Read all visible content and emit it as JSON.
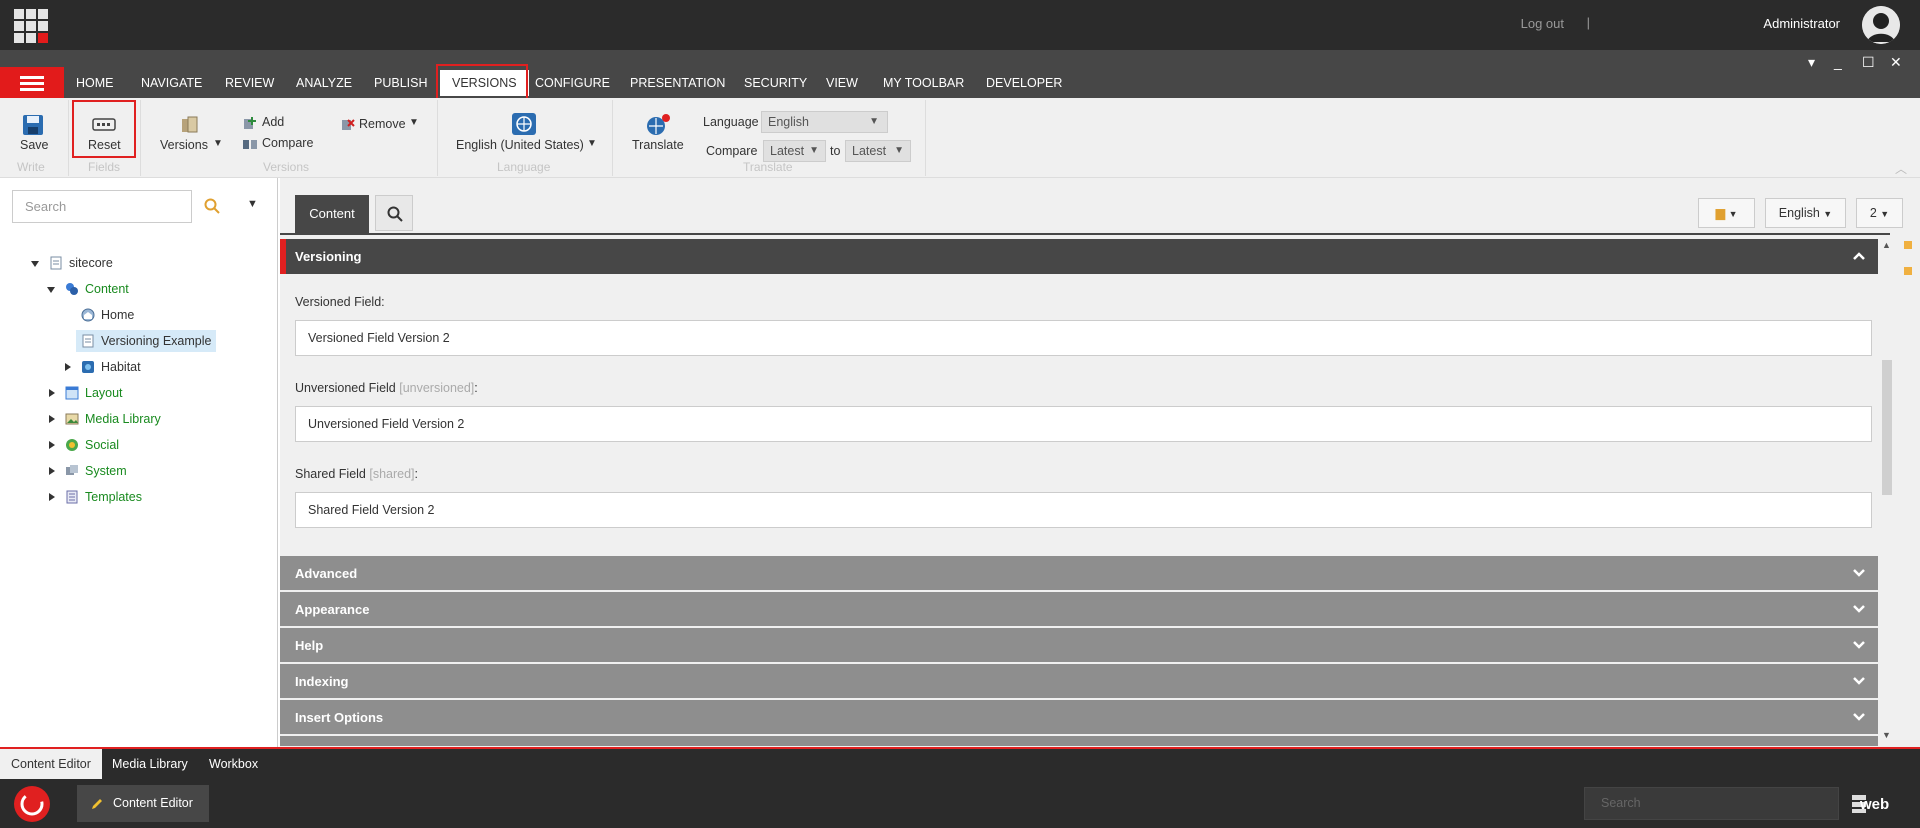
{
  "top_bar": {
    "logout": "Log out",
    "separator": "|",
    "user": "Administrator"
  },
  "ribbon_tabs": [
    "HOME",
    "NAVIGATE",
    "REVIEW",
    "ANALYZE",
    "PUBLISH",
    "VERSIONS",
    "CONFIGURE",
    "PRESENTATION",
    "SECURITY",
    "VIEW",
    "MY TOOLBAR",
    "DEVELOPER"
  ],
  "active_ribbon_tab": "VERSIONS",
  "ribbon": {
    "write": {
      "save": "Save",
      "group": "Write"
    },
    "fields": {
      "reset": "Reset",
      "group": "Fields"
    },
    "versions": {
      "versions": "Versions",
      "add": "Add",
      "compare": "Compare",
      "remove": "Remove",
      "group": "Versions"
    },
    "language": {
      "current": "English (United States)",
      "group": "Language"
    },
    "translate": {
      "translate": "Translate",
      "language_label": "Language",
      "language_value": "English",
      "compare_label": "Compare",
      "compare_from": "Latest",
      "to_label": "to",
      "compare_to": "Latest",
      "group": "Translate"
    }
  },
  "tree": {
    "search_placeholder": "Search",
    "items": {
      "sitecore": "sitecore",
      "content": "Content",
      "home": "Home",
      "versioning_example": "Versioning Example",
      "habitat": "Habitat",
      "layout": "Layout",
      "media_library": "Media Library",
      "social": "Social",
      "system": "System",
      "templates": "Templates"
    }
  },
  "editor": {
    "content_tab": "Content",
    "language_button": "English",
    "version_button": "2",
    "section_title": "Versioning",
    "fields": [
      {
        "label": "Versioned Field:",
        "suffix": "",
        "value": "Versioned Field Version 2"
      },
      {
        "label": "Unversioned Field ",
        "suffix": "[unversioned]",
        "colon": ":",
        "value": "Unversioned Field Version 2"
      },
      {
        "label": "Shared Field ",
        "suffix": "[shared]",
        "colon": ":",
        "value": "Shared Field Version 2"
      }
    ],
    "collapsed_sections": [
      "Advanced",
      "Appearance",
      "Help",
      "Indexing",
      "Insert Options"
    ]
  },
  "bottom_tabs": [
    "Content Editor",
    "Media Library",
    "Workbox"
  ],
  "taskbar": {
    "app": "Content Editor",
    "search_placeholder": "Search",
    "database": "web"
  },
  "colors": {
    "accent": "#e02020",
    "dark": "#2b2b2b",
    "tab_bar": "#474747",
    "tree_link": "#198a1f"
  }
}
